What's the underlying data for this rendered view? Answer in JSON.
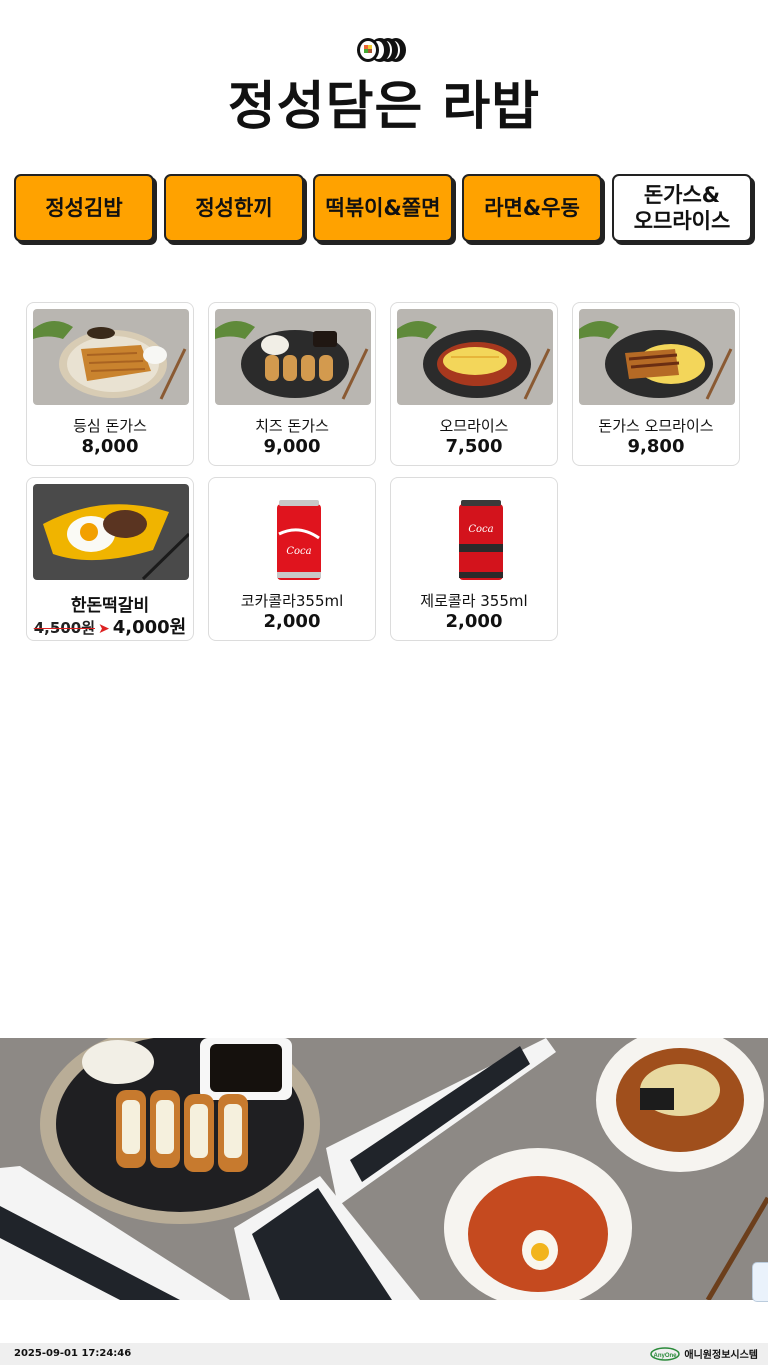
{
  "header": {
    "title": "정성담은 라밥"
  },
  "tabs": [
    {
      "label": "정성김밥",
      "active": false
    },
    {
      "label": "정성한끼",
      "active": false
    },
    {
      "label": "떡볶이&쫄면",
      "active": false
    },
    {
      "label": "라면&우동",
      "active": false
    },
    {
      "label": "돈가스&\n오므라이스",
      "active": true
    }
  ],
  "menu_items": [
    {
      "name": "등심 돈가스",
      "price": "8,000"
    },
    {
      "name": "치즈 돈가스",
      "price": "9,000"
    },
    {
      "name": "오므라이스",
      "price": "7,500"
    },
    {
      "name": "돈가스 오므라이스",
      "price": "9,800"
    },
    {
      "name": "한돈떡갈비",
      "old_price": "4,500원",
      "new_price": "4,000원"
    },
    {
      "name": "코카콜라355ml",
      "price": "2,000"
    },
    {
      "name": "제로콜라 355ml",
      "price": "2,000"
    }
  ],
  "footer": {
    "timestamp": "2025-09-01 17:24:46",
    "brand": "애니원정보시스템",
    "brand_badge": "AnyOne"
  },
  "colors": {
    "tab_orange": "#ffa200",
    "tab_active": "#ffffff",
    "border": "#222222"
  }
}
